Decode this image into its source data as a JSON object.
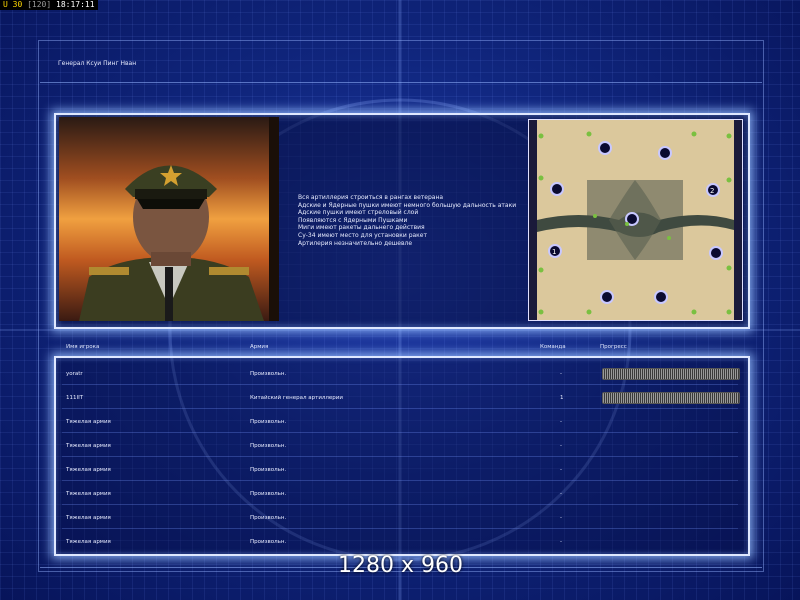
{
  "hud": {
    "left": "U 30",
    "bracket": "[120]",
    "time": "18:17:11"
  },
  "title": "Генерал Ксуи Пинг Нван",
  "description": [
    "Вся артиллерия строиться в рангах ветерана",
    "Адские и Ядерные пушки имеют немного большую дальность атаки",
    "Адские пушки имеют стреловый слой",
    "Появляются с Ядерными Пушками",
    "Миги имеют ракеты дальнего действия",
    "Су-34 имеют место для установки ракет",
    "Артилерия незначительно дешевле"
  ],
  "map_labels": {
    "spawn1": "1",
    "spawn2": "2"
  },
  "table_headers": {
    "name": "Имя игрока",
    "army": "Армия",
    "team": "Команда",
    "progress": "Прогресс"
  },
  "players": [
    {
      "name": "yoratr",
      "army": "Произвольн.",
      "team": "-",
      "progress": 1.0
    },
    {
      "name": "111IIT",
      "army": "Китайский генерал артиллерии",
      "team": "1",
      "progress": 1.0
    },
    {
      "name": "Тяжелая армия",
      "army": "Произвольн.",
      "team": "-",
      "progress": null
    },
    {
      "name": "Тяжелая армия",
      "army": "Произвольн.",
      "team": "-",
      "progress": null
    },
    {
      "name": "Тяжелая армия",
      "army": "Произвольн.",
      "team": "-",
      "progress": null
    },
    {
      "name": "Тяжелая армия",
      "army": "Произвольн.",
      "team": "-",
      "progress": null
    },
    {
      "name": "Тяжелая армия",
      "army": "Произвольн.",
      "team": "-",
      "progress": null
    },
    {
      "name": "Тяжелая армия",
      "army": "Произвольн.",
      "team": "-",
      "progress": null
    }
  ],
  "resolution_watermark": "1280 x 960"
}
